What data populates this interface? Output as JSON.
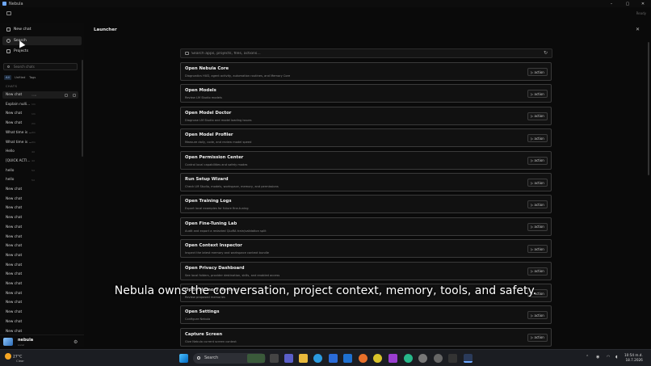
{
  "window": {
    "title": "Nebula",
    "min": "–",
    "max": "▢",
    "close": "✕",
    "top_right_label": "Ready"
  },
  "sidebar": {
    "nav": [
      {
        "label": "New chat",
        "icon": "compose-icon"
      },
      {
        "label": "Search",
        "icon": "search-icon"
      },
      {
        "label": "Projects",
        "icon": "folder-icon"
      }
    ],
    "search_placeholder": "Search chats",
    "filters": [
      "All",
      "Unfiled",
      "Tags"
    ],
    "section_label": "CHATS",
    "chats": [
      {
        "label": "New chat",
        "age": "now"
      },
      {
        "label": "Explain nulli...",
        "age": "1m"
      },
      {
        "label": "New chat",
        "age": "1m"
      },
      {
        "label": "New chat",
        "age": "2m"
      },
      {
        "label": "What time is ...",
        "age": "3m"
      },
      {
        "label": "What time is ...",
        "age": "3m"
      },
      {
        "label": "Hello",
        "age": "4d"
      },
      {
        "label": "[QUICK ACTI...",
        "age": "4d"
      },
      {
        "label": "hello",
        "age": "5d"
      },
      {
        "label": "hello",
        "age": "5d"
      },
      {
        "label": "New chat",
        "age": ""
      },
      {
        "label": "New chat",
        "age": ""
      },
      {
        "label": "New chat",
        "age": ""
      },
      {
        "label": "New chat",
        "age": ""
      },
      {
        "label": "New chat",
        "age": ""
      },
      {
        "label": "New chat",
        "age": ""
      },
      {
        "label": "New chat",
        "age": ""
      },
      {
        "label": "New chat",
        "age": ""
      },
      {
        "label": "New chat",
        "age": ""
      },
      {
        "label": "New chat",
        "age": ""
      },
      {
        "label": "New chat",
        "age": ""
      },
      {
        "label": "New chat",
        "age": ""
      },
      {
        "label": "New chat",
        "age": ""
      },
      {
        "label": "New chat",
        "age": ""
      },
      {
        "label": "New chat",
        "age": ""
      },
      {
        "label": "New chat",
        "age": ""
      }
    ],
    "user": {
      "name": "nebula",
      "plan": "Local"
    }
  },
  "main": {
    "title": "Launcher",
    "close": "✕",
    "search_placeholder": "Search apps, projects, files, actions...",
    "refresh": "↻",
    "commands": [
      {
        "title": "Open Nebula Core",
        "desc": "Diagnostics HUD, agent activity, automation routines, and Memory Core",
        "action": "▷ action"
      },
      {
        "title": "Open Models",
        "desc": "Review LM Studio models",
        "action": "▷ action"
      },
      {
        "title": "Open Model Doctor",
        "desc": "Diagnose LM Studio and model loading issues",
        "action": "▷ action"
      },
      {
        "title": "Open Model Profiler",
        "desc": "Measure daily, code, and review model speed",
        "action": "▷ action"
      },
      {
        "title": "Open Permission Center",
        "desc": "Control local capabilities and safety modes",
        "action": "▷ action"
      },
      {
        "title": "Run Setup Wizard",
        "desc": "Check LM Studio, models, workspace, memory, and permissions",
        "action": "▷ action"
      },
      {
        "title": "Open Training Logs",
        "desc": "Export local examples for future fine-tuning",
        "action": "▷ action"
      },
      {
        "title": "Open Fine-Tuning Lab",
        "desc": "Audit and export a redacted QLoRA train/validation split",
        "action": "▷ action"
      },
      {
        "title": "Open Context Inspector",
        "desc": "Inspect the latest memory and workspace context bundle",
        "action": "▷ action"
      },
      {
        "title": "Open Privacy Dashboard",
        "desc": "See local folders, provider destination, skills, and enabled access",
        "action": "▷ action"
      },
      {
        "title": "Open Memory Review",
        "desc": "Review proposed memories",
        "action": "▷ action"
      },
      {
        "title": "Open Settings",
        "desc": "Configure Nebula",
        "action": "▷ action"
      },
      {
        "title": "Capture Screen",
        "desc": "Give Nebula current screen context",
        "action": "▷ action"
      }
    ]
  },
  "caption": "Nebula owns the conversation, project context, memory, tools, and safety.",
  "taskbar": {
    "weather_temp": "27°C",
    "weather_desc": "Clear",
    "search_label": "Search",
    "time": "10:54 m.d.",
    "date": "18.7.2026"
  }
}
